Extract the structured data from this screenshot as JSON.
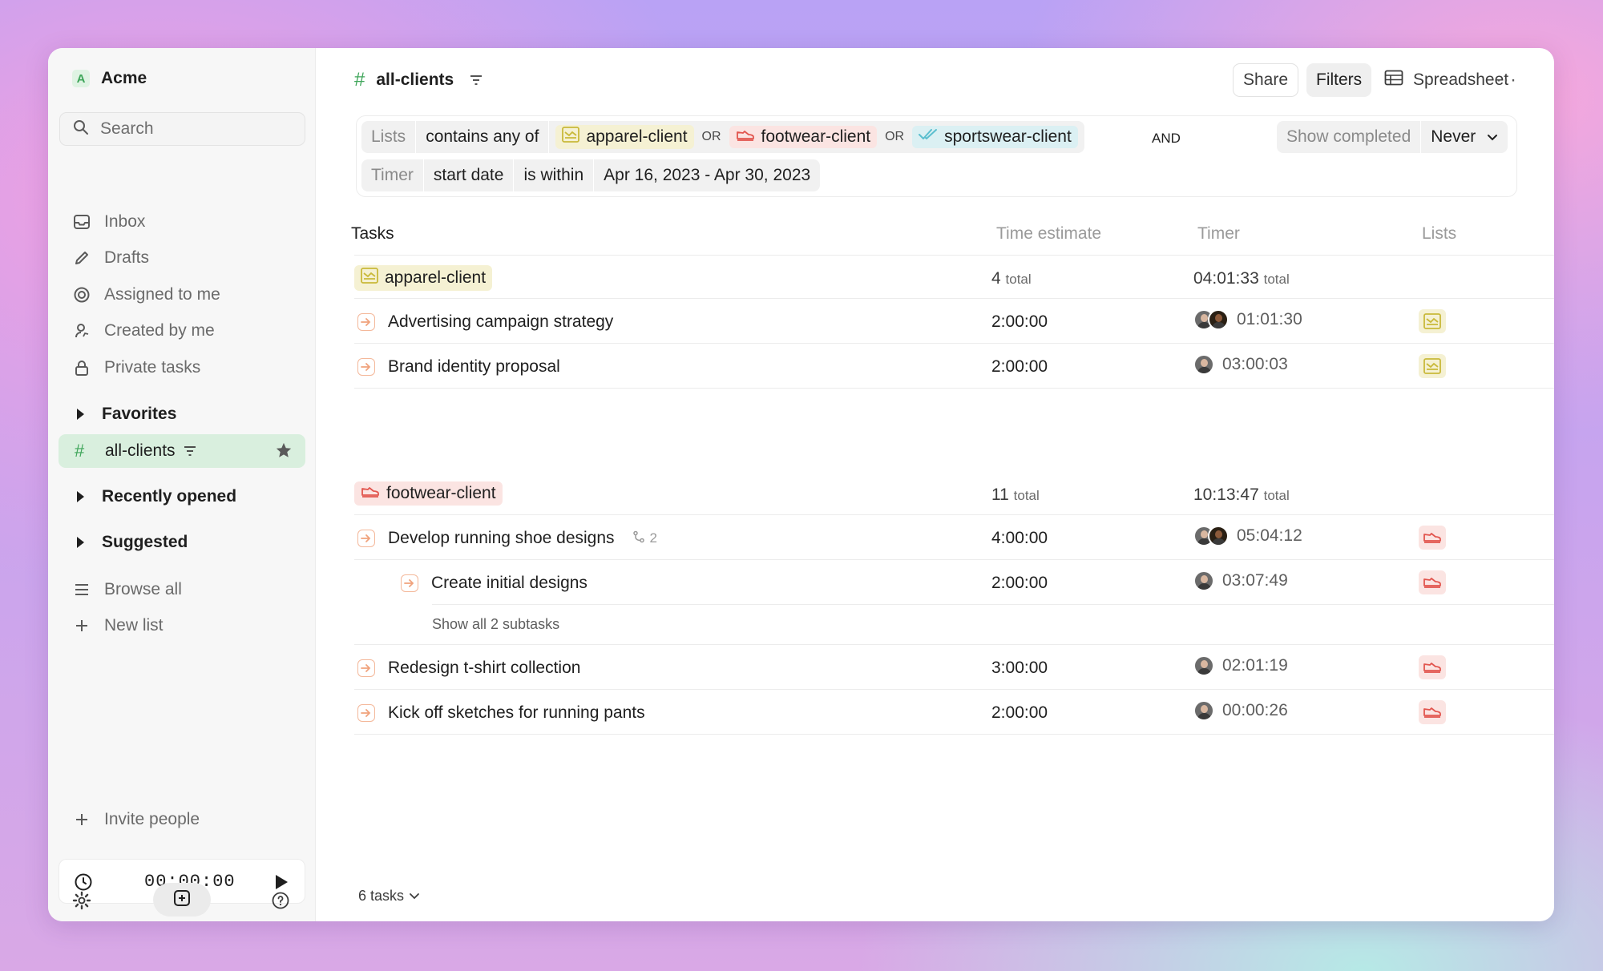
{
  "workspace": {
    "logo_letter": "A",
    "name": "Acme"
  },
  "search": {
    "placeholder": "Search"
  },
  "nav": {
    "inbox": "Inbox",
    "drafts": "Drafts",
    "assigned": "Assigned to me",
    "created": "Created by me",
    "private": "Private tasks"
  },
  "sections": {
    "favorites": "Favorites",
    "recent": "Recently opened",
    "suggested": "Suggested",
    "browse": "Browse all",
    "new_list": "New list",
    "invite": "Invite people"
  },
  "favorite_item": {
    "label": "all-clients"
  },
  "timer_widget": {
    "time": "00:00:00"
  },
  "header": {
    "title": "all-clients",
    "share": "Share",
    "filters": "Filters",
    "view": "Spreadsheet"
  },
  "filter": {
    "row1": {
      "field": "Lists",
      "operator": "contains any of",
      "values": [
        "apparel-client",
        "footwear-client",
        "sportswear-client"
      ],
      "or": "OR"
    },
    "and": "AND",
    "show_completed_label": "Show completed",
    "show_completed_value": "Never",
    "row2": {
      "field": "Timer",
      "attr": "start date",
      "operator": "is within",
      "value": "Apr 16, 2023 - Apr 30, 2023"
    }
  },
  "columns": {
    "tasks": "Tasks",
    "estimate": "Time estimate",
    "timer": "Timer",
    "lists": "Lists"
  },
  "groups": [
    {
      "name": "apparel-client",
      "total_estimate": "4",
      "total_timer": "04:01:33",
      "total_suffix": "total",
      "rows": [
        {
          "title": "Advertising campaign strategy",
          "estimate": "2:00:00",
          "timer": "01:01:30"
        },
        {
          "title": "Brand identity proposal",
          "estimate": "2:00:00",
          "timer": "03:00:03"
        }
      ]
    },
    {
      "name": "footwear-client",
      "total_estimate": "11",
      "total_timer": "10:13:47",
      "total_suffix": "total",
      "rows": [
        {
          "title": "Develop running shoe designs",
          "subtask_count": "2",
          "estimate": "4:00:00",
          "timer": "05:04:12"
        },
        {
          "title": "Create initial designs",
          "estimate": "2:00:00",
          "timer": "03:07:49"
        },
        {
          "title": "Redesign t-shirt collection",
          "estimate": "3:00:00",
          "timer": "02:01:19"
        },
        {
          "title": "Kick off sketches for running pants",
          "estimate": "2:00:00",
          "timer": "00:00:26"
        }
      ],
      "show_all": "Show all 2 subtasks"
    }
  ],
  "footer": {
    "count": "6 tasks"
  },
  "colors": {
    "accent_green": "#3fa65a",
    "apparel": "#c9b93a",
    "footwear": "#e2554e",
    "sportswear": "#5bbfcf"
  }
}
